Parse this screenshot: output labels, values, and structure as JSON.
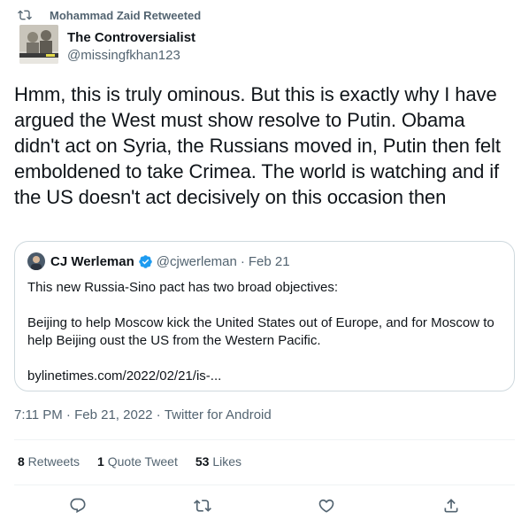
{
  "retweet": {
    "text": "Mohammad Zaid Retweeted",
    "icon": "retweet-icon"
  },
  "author": {
    "name": "The Controversialist",
    "handle": "@missingfkhan123"
  },
  "tweet": {
    "text": "Hmm, this is truly ominous. But this is exactly why I have argued the West must show resolve to Putin. Obama didn't act on Syria, the Russians moved in, Putin then felt emboldened to take Crimea. The world is watching and if the US doesn't act decisively on this occasion then"
  },
  "quote": {
    "name": "CJ Werleman",
    "verified_icon": "verified-badge-icon",
    "handle": "@cjwerleman",
    "separator": "·",
    "date": "Feb 21",
    "line1": "This new Russia-Sino pact has two broad objectives:",
    "line2": "Beijing to help Moscow kick the United States out of Europe, and for Moscow to help Beijing oust the US from the Western Pacific.",
    "link": "bylinetimes.com/2022/02/21/is-..."
  },
  "meta": {
    "time": "7:11 PM",
    "sep1": " · ",
    "date": "Feb 21, 2022",
    "sep2": " · ",
    "source": "Twitter for Android"
  },
  "stats": {
    "retweets_count": "8",
    "retweets_label": " Retweets",
    "quotes_count": "1",
    "quotes_label": " Quote Tweet",
    "likes_count": "53",
    "likes_label": " Likes"
  },
  "actions": [
    "reply-icon",
    "retweet-icon",
    "like-icon",
    "share-icon"
  ],
  "colors": {
    "text": "#0f1419",
    "secondary": "#536471",
    "border": "#cfd9de",
    "verified": "#1d9bf0"
  }
}
